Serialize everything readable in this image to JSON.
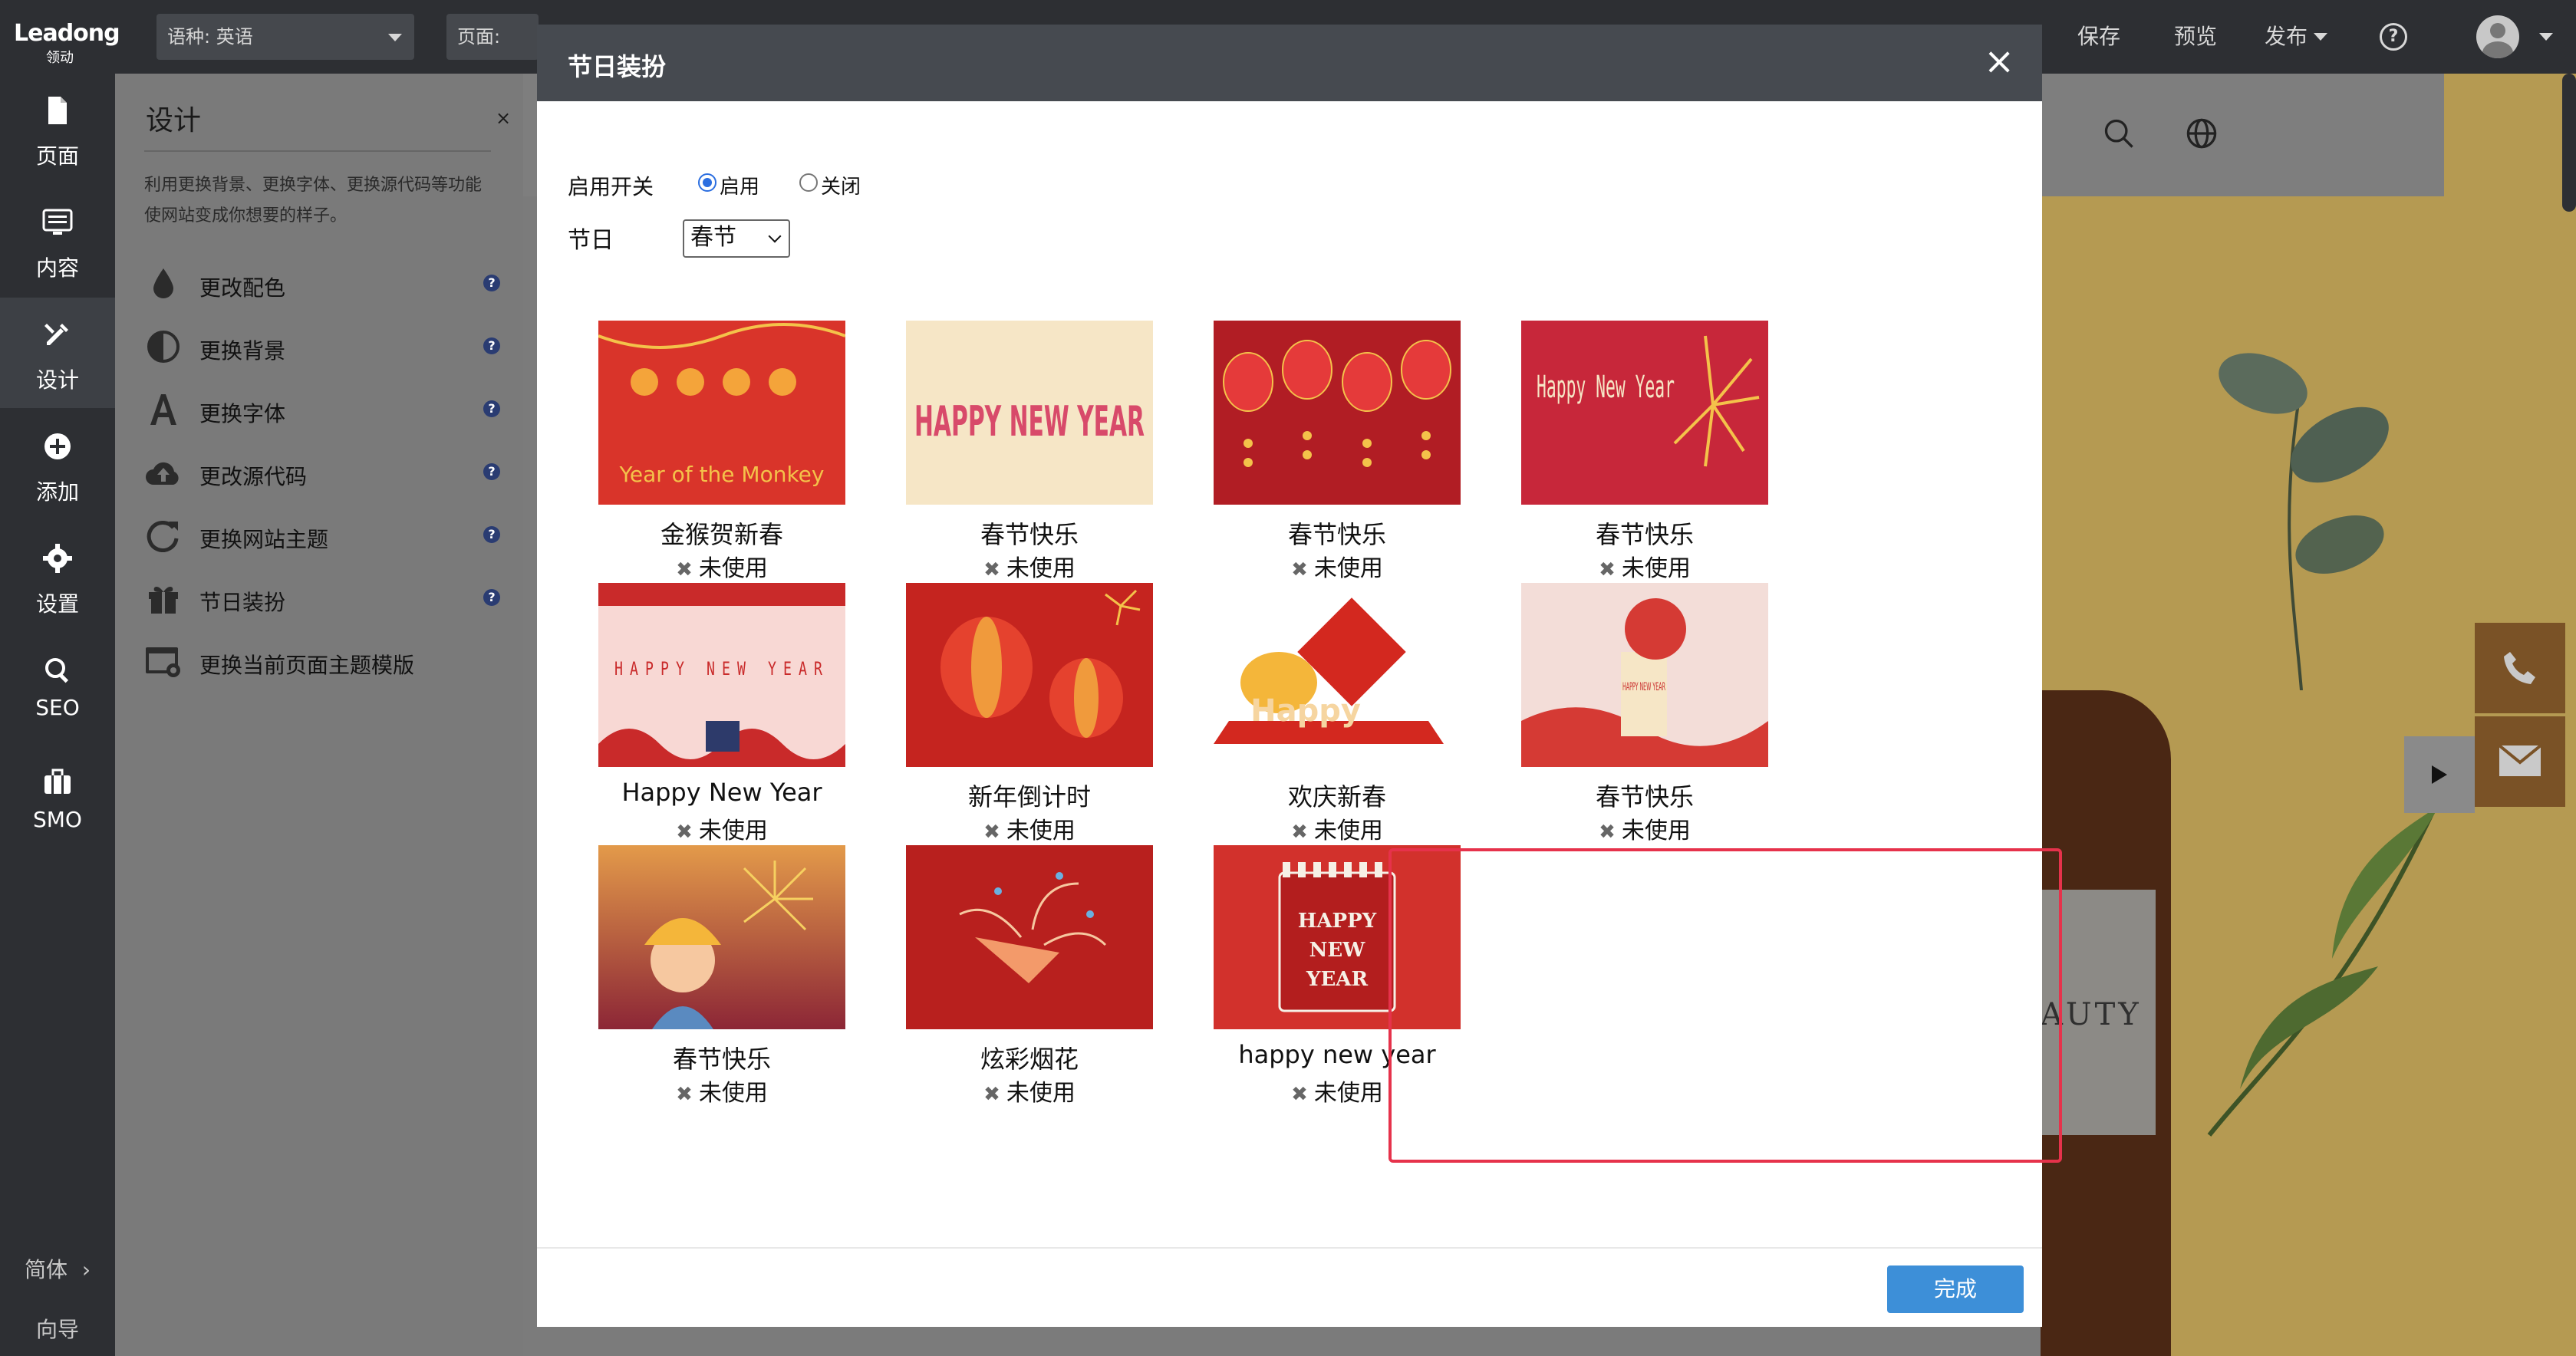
{
  "topbar": {
    "logo_main": "Leadong",
    "logo_sub": "领动",
    "language_select": "语种: 英语",
    "page_select": "页面: Hor",
    "save": "保存",
    "preview": "预览",
    "publish": "发布",
    "help_glyph": "?"
  },
  "rail": {
    "items": [
      {
        "label": "页面",
        "icon": "page-icon"
      },
      {
        "label": "内容",
        "icon": "content-icon"
      },
      {
        "label": "设计",
        "icon": "design-icon"
      },
      {
        "label": "添加",
        "icon": "add-icon"
      },
      {
        "label": "设置",
        "icon": "gear-icon"
      },
      {
        "label": "SEO",
        "icon": "search-icon"
      },
      {
        "label": "SMO",
        "icon": "briefcase-icon"
      }
    ],
    "lang_switch": "简体",
    "guide": "向导"
  },
  "panel": {
    "title": "设计",
    "close": "×",
    "description": "利用更换背景、更换字体、更换源代码等功能使网站变成你想要的样子。",
    "items": [
      {
        "label": "更改配色",
        "icon": "color-drop-icon",
        "help": "?"
      },
      {
        "label": "更换背景",
        "icon": "contrast-icon",
        "help": "?"
      },
      {
        "label": "更换字体",
        "icon": "font-icon",
        "help": "?"
      },
      {
        "label": "更改源代码",
        "icon": "cloud-upload-icon",
        "help": "?"
      },
      {
        "label": "更换网站主题",
        "icon": "refresh-icon",
        "help": "?"
      },
      {
        "label": "节日装扮",
        "icon": "gift-icon",
        "help": "?"
      },
      {
        "label": "更换当前页面主题模版",
        "icon": "template-icon"
      }
    ]
  },
  "preview": {
    "brand_text": "AUTY"
  },
  "modal": {
    "title": "节日装扮",
    "close": "×",
    "switch_label": "启用开关",
    "enable_label": "启用",
    "disable_label": "关闭",
    "holiday_label": "节日",
    "holiday_value": "春节",
    "status_mark": "✖",
    "done": "完成",
    "decorations": [
      {
        "name": "金猴贺新春",
        "status": "未使用",
        "thumb": "Year of the Monkey",
        "bg": "#d9342a"
      },
      {
        "name": "春节快乐",
        "status": "未使用",
        "thumb": "HAPPY NEW YEAR",
        "bg": "#f6e6c6"
      },
      {
        "name": "春节快乐",
        "status": "未使用",
        "thumb": "",
        "bg": "#b11d24"
      },
      {
        "name": "春节快乐",
        "status": "未使用",
        "thumb": "Happy New Year",
        "bg": "#c7273a"
      },
      {
        "name": "Happy New Year",
        "status": "未使用",
        "thumb": "HAPPY NEW YEAR",
        "bg": "#f8d8d4"
      },
      {
        "name": "新年倒计时",
        "status": "未使用",
        "thumb": "",
        "bg": "#c5241f"
      },
      {
        "name": "欢庆新春",
        "status": "未使用",
        "thumb": "Happy",
        "bg": "#ffffff"
      },
      {
        "name": "春节快乐",
        "status": "未使用",
        "thumb": "HAPPY NEW YEAR",
        "bg": "#f3ddd8"
      },
      {
        "name": "春节快乐",
        "status": "未使用",
        "thumb": "",
        "bg": "#c2504a"
      },
      {
        "name": "炫彩烟花",
        "status": "未使用",
        "thumb": "",
        "bg": "#b8201e"
      },
      {
        "name": "happy new year",
        "status": "未使用",
        "thumb": "HAPPY NEW YEAR",
        "bg": "#d2312c"
      }
    ]
  }
}
